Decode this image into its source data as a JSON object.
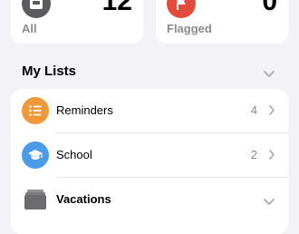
{
  "summary": {
    "all": {
      "count": "12",
      "label": "All",
      "icon": "tray-icon",
      "color": "#5a5a5f"
    },
    "flagged": {
      "count": "0",
      "label": "Flagged",
      "icon": "flag-icon",
      "color": "#e54b3c"
    }
  },
  "my_lists": {
    "title": "My Lists",
    "items": [
      {
        "label": "Reminders",
        "count": "4",
        "icon": "list-bullet-icon",
        "color": "#f0983a"
      },
      {
        "label": "School",
        "count": "2",
        "icon": "graduation-cap-icon",
        "color": "#4a9be8"
      },
      {
        "label": "Vacations",
        "icon": "folder-stack-icon",
        "color": "#6b6b70"
      }
    ]
  }
}
